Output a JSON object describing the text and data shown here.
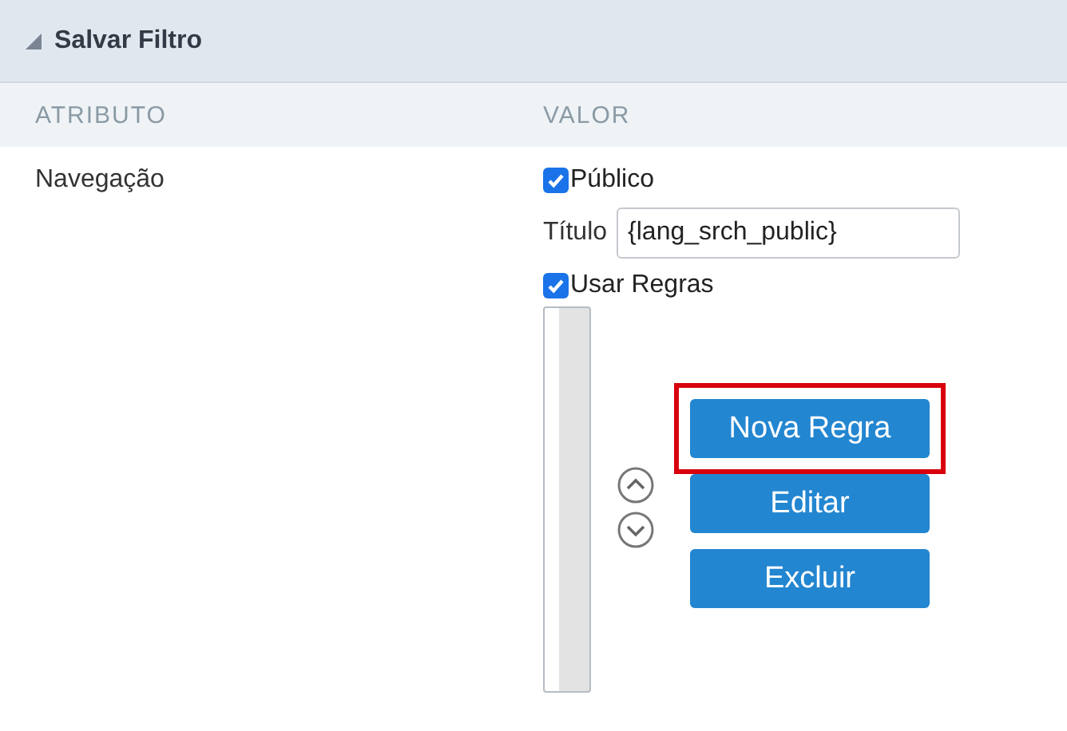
{
  "panel": {
    "title": "Salvar Filtro",
    "expanded": true
  },
  "columns": [
    "ATRIBUTO",
    "VALOR"
  ],
  "row": {
    "attribute": "Navegação",
    "public": {
      "label": "Público",
      "checked": true
    },
    "title_field": {
      "label": "Título",
      "value": "{lang_srch_public}"
    },
    "use_rules": {
      "label": "Usar Regras",
      "checked": true
    },
    "buttons": [
      {
        "label": "Nova Regra",
        "highlighted": true
      },
      {
        "label": "Editar",
        "highlighted": false
      },
      {
        "label": "Excluir",
        "highlighted": false
      }
    ]
  }
}
